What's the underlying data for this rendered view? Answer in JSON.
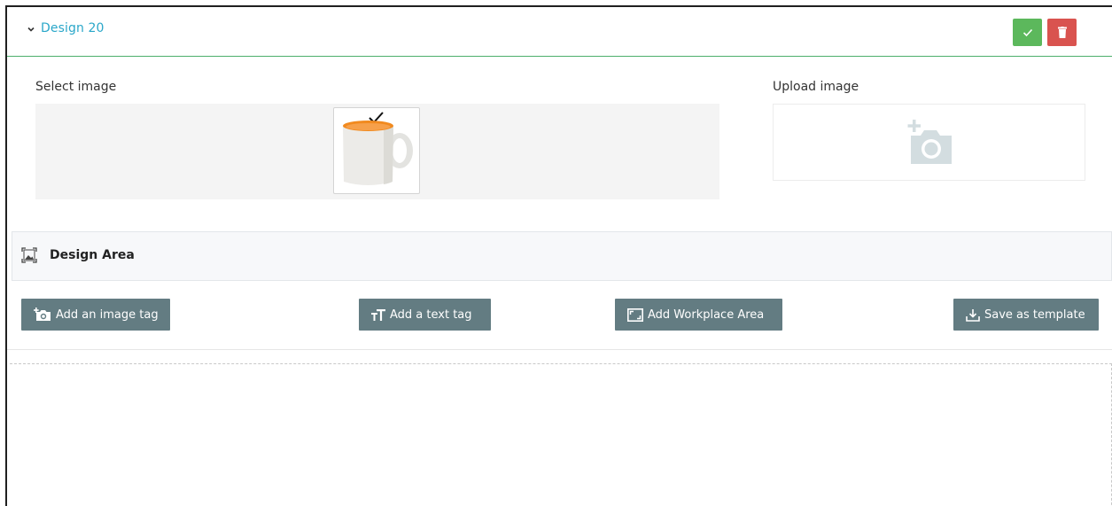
{
  "header": {
    "title": "Design 20",
    "confirm_icon": "check-icon",
    "delete_icon": "trash-icon",
    "accent_color": "#2aa7c9",
    "confirm_color": "#5cb85c",
    "delete_color": "#d9534f"
  },
  "select_image": {
    "label": "Select image",
    "thumbnail": "mug-image",
    "selected": true
  },
  "upload_image": {
    "label": "Upload image",
    "icon": "add-camera-icon"
  },
  "design_area": {
    "title": "Design Area",
    "icon": "image-frame-icon"
  },
  "tools": [
    {
      "label": "Add an image tag",
      "icon": "camera-plus-icon"
    },
    {
      "label": "Add a text tag",
      "icon": "text-size-icon"
    },
    {
      "label": "Add Workplace Area",
      "icon": "frame-icon"
    },
    {
      "label": "Save as template",
      "icon": "download-icon"
    }
  ],
  "tool_color": "#637c82"
}
